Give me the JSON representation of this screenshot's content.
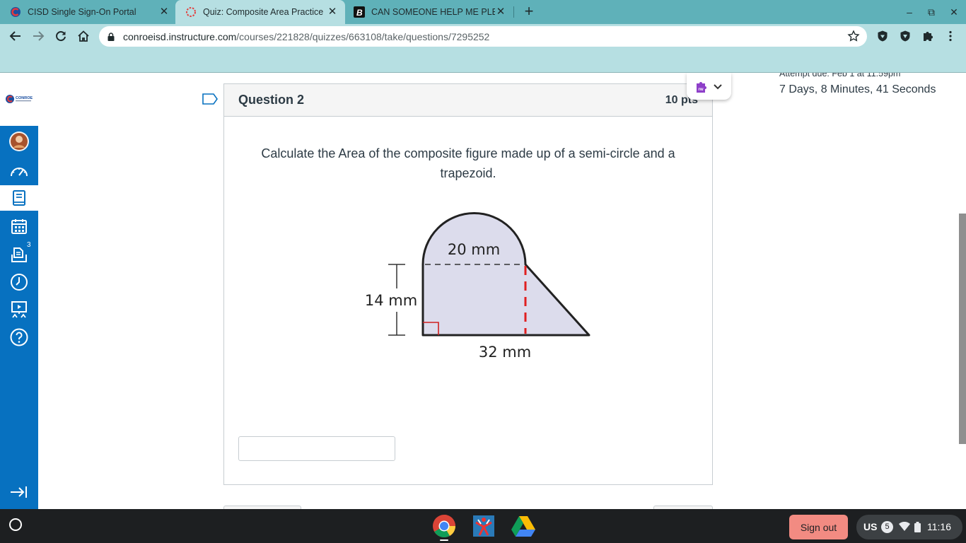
{
  "browser": {
    "tabs": [
      {
        "title": "CISD Single Sign-On Portal",
        "active": false
      },
      {
        "title": "Quiz: Composite Area Practice",
        "active": true
      },
      {
        "title": "CAN SOMEONE HELP ME PLEAS",
        "active": false
      }
    ],
    "tab_close_glyph": "✕",
    "new_tab_glyph": "+",
    "window_controls": {
      "minimize": "–",
      "restore": "⧉",
      "close": "✕"
    },
    "url_host": "conroeisd.instructure.com",
    "url_path": "/courses/221828/quizzes/663108/take/questions/7295252"
  },
  "leftnav": {
    "logo_text": "CONROE",
    "items": [
      "avatar",
      "dashboard-icon",
      "courses-icon",
      "calendar-icon",
      "inbox-icon",
      "history-icon",
      "studio-icon",
      "help-icon"
    ],
    "active_item": "courses-icon",
    "inbox_badge": "3",
    "accent_color": "#0771c0"
  },
  "question": {
    "title": "Question 2",
    "points": "10 pts",
    "prompt": "Calculate the Area of the composite figure made up of a semi-circle and a trapezoid.",
    "figure_labels": {
      "top_width": "20 mm",
      "height": "14 mm",
      "base": "32 mm"
    },
    "answer_value": ""
  },
  "timer": {
    "attempt_due": "Attempt due: Feb 1 at 11:59pm",
    "time_remaining": "7 Days, 8 Minutes, 41 Seconds"
  },
  "shelf": {
    "apps": [
      "chrome-icon",
      "stick-figure-app-icon",
      "google-drive-icon"
    ],
    "signout_label": "Sign out",
    "locale": "US",
    "notification_count": "5",
    "clock": "11:16"
  }
}
